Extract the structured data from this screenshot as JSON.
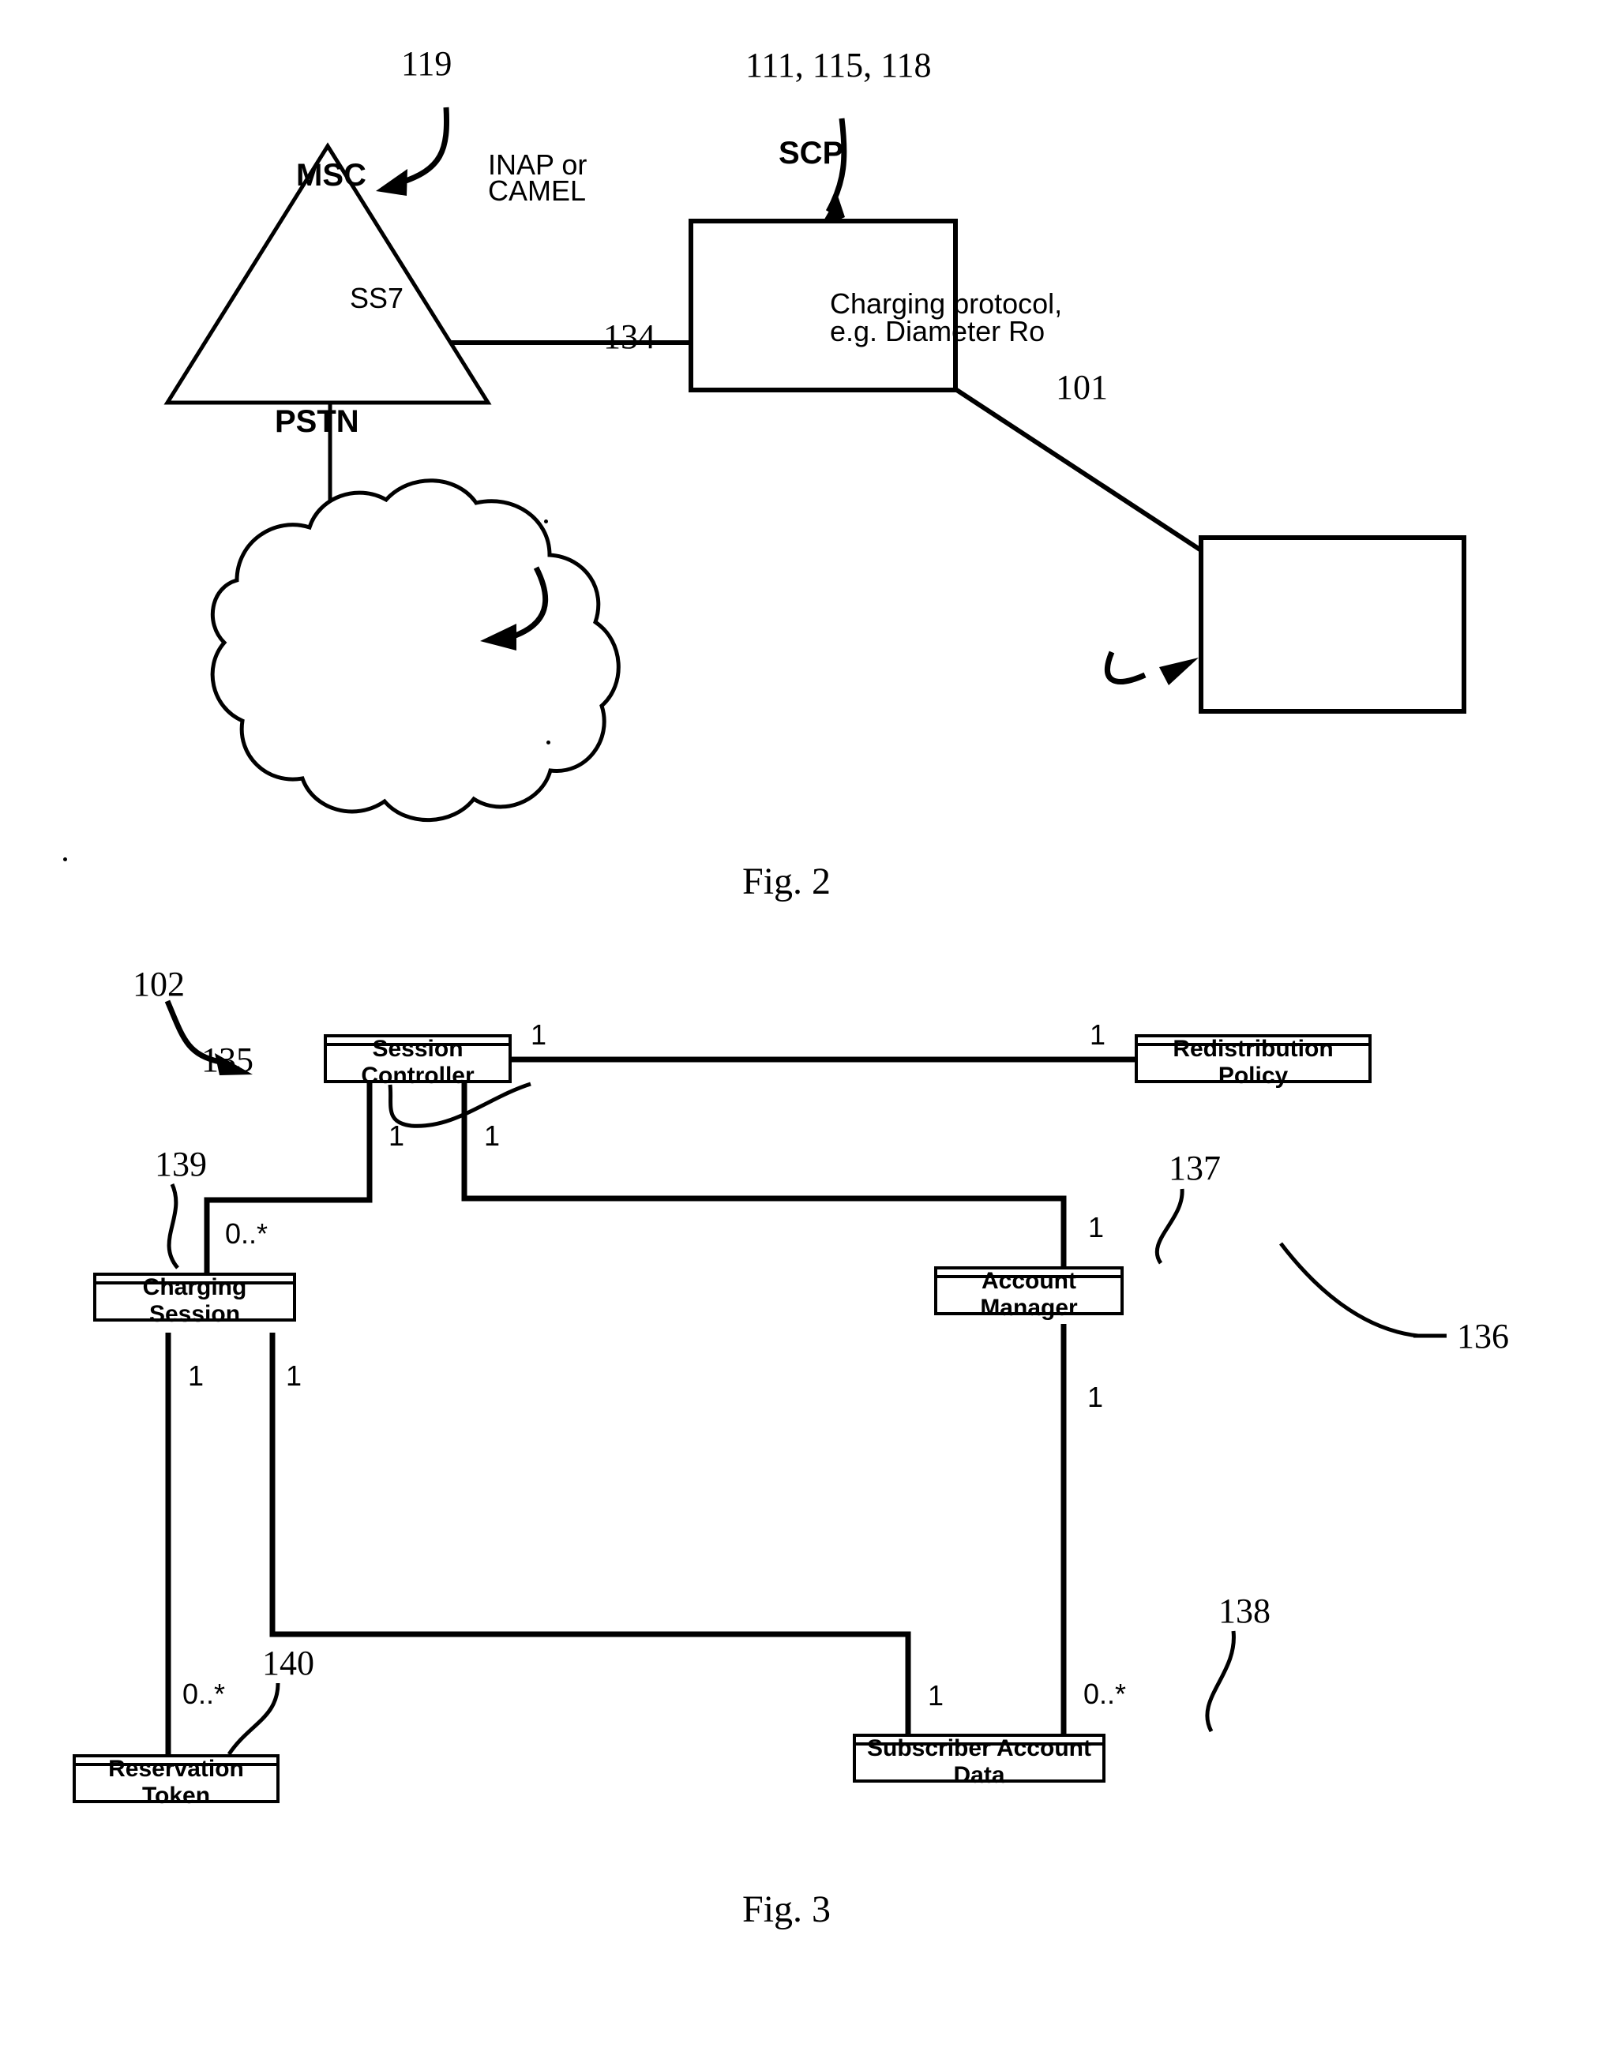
{
  "figures": [
    {
      "id": "fig2",
      "caption": "Fig. 2",
      "nodes": [
        {
          "key": "msc",
          "label": "MSC",
          "shape": "triangle"
        },
        {
          "key": "scp",
          "label": "SCP",
          "shape": "rectangle"
        },
        {
          "key": "pstn",
          "label": "PSTN",
          "shape": "cloud"
        },
        {
          "key": "node101",
          "label": "",
          "shape": "rectangle"
        }
      ],
      "reference_numerals": [
        {
          "key": "ref119",
          "text": "119",
          "points_to": "msc"
        },
        {
          "key": "ref111",
          "text": "111, 115, 118",
          "points_to": "scp"
        },
        {
          "key": "ref134",
          "text": "134",
          "points_to": "pstn"
        },
        {
          "key": "ref101",
          "text": "101",
          "points_to": "node101"
        }
      ],
      "link_labels": [
        {
          "key": "inap",
          "line1": "INAP or",
          "line2": "CAMEL",
          "from": "msc",
          "to": "scp"
        },
        {
          "key": "ss7",
          "line1": "SS7",
          "line2": "",
          "from": "msc",
          "to": "pstn"
        },
        {
          "key": "charg",
          "line1": "Charging protocol,",
          "line2": "e.g. Diameter Ro",
          "from": "scp",
          "to": "node101"
        }
      ]
    },
    {
      "id": "fig3",
      "caption": "Fig. 3",
      "classes": [
        {
          "key": "session_controller",
          "name": "Session Controller"
        },
        {
          "key": "redistribution_policy",
          "name": "Redistribution Policy"
        },
        {
          "key": "charging_session",
          "name": "Charging Session"
        },
        {
          "key": "account_manager",
          "name": "Account Manager"
        },
        {
          "key": "subscriber_account",
          "name": "Subscriber Account Data"
        },
        {
          "key": "reservation_token",
          "name": "Reservation Token"
        }
      ],
      "reference_numerals": [
        {
          "key": "ref102",
          "text": "102",
          "points_to": "fig3-diagram"
        },
        {
          "key": "ref135",
          "text": "135",
          "points_to": "session_controller"
        },
        {
          "key": "ref136",
          "text": "136",
          "points_to": "redistribution_policy"
        },
        {
          "key": "ref137",
          "text": "137",
          "points_to": "account_manager"
        },
        {
          "key": "ref138",
          "text": "138",
          "points_to": "subscriber_account"
        },
        {
          "key": "ref139",
          "text": "139",
          "points_to": "charging_session"
        },
        {
          "key": "ref140",
          "text": "140",
          "points_to": "reservation_token"
        }
      ],
      "associations": [
        {
          "key": "sc_rp",
          "from": "session_controller",
          "to": "redistribution_policy",
          "from_mult": "1",
          "to_mult": "1"
        },
        {
          "key": "sc_cs",
          "from": "session_controller",
          "to": "charging_session",
          "from_mult": "1",
          "to_mult": "0..*"
        },
        {
          "key": "sc_am",
          "from": "session_controller",
          "to": "account_manager",
          "from_mult": "1",
          "to_mult": "1"
        },
        {
          "key": "cs_rt",
          "from": "charging_session",
          "to": "reservation_token",
          "from_mult": "1",
          "to_mult": "0..*"
        },
        {
          "key": "cs_sad",
          "from": "charging_session",
          "to": "subscriber_account",
          "from_mult": "1",
          "to_mult": "1"
        },
        {
          "key": "am_sad",
          "from": "account_manager",
          "to": "subscriber_account",
          "from_mult": "1",
          "to_mult": "0..*"
        }
      ],
      "multiplicity_marks": [
        {
          "key": "m_sc_right",
          "text": "1"
        },
        {
          "key": "m_rp_left",
          "text": "1"
        },
        {
          "key": "m_sc_down_l",
          "text": "1"
        },
        {
          "key": "m_sc_down_r",
          "text": "1"
        },
        {
          "key": "m_cs_top",
          "text": "0..*"
        },
        {
          "key": "m_am_top",
          "text": "1"
        },
        {
          "key": "m_cs_down_l",
          "text": "1"
        },
        {
          "key": "m_cs_down_r",
          "text": "1"
        },
        {
          "key": "m_am_down",
          "text": "1"
        },
        {
          "key": "m_rt_top",
          "text": "0..*"
        },
        {
          "key": "m_sad_left",
          "text": "1"
        },
        {
          "key": "m_sad_right",
          "text": "0..*"
        }
      ]
    }
  ]
}
